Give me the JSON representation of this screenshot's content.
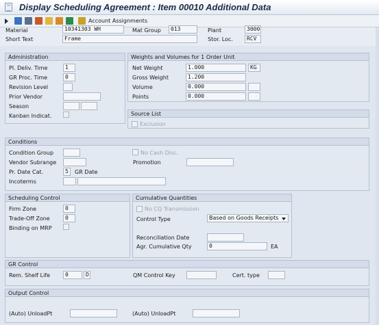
{
  "window": {
    "title": "Display Scheduling Agreement : Item 00010 Additional Data"
  },
  "toolbar": {
    "icons": [
      "execute-arrow-icon",
      "print-icon",
      "find-icon",
      "find-next-icon",
      "create-icon",
      "change-icon",
      "display-icon",
      "document-icon"
    ],
    "account_assignments_label": "Account Assignments"
  },
  "header": {
    "material_label": "Material",
    "material_value": "10341303 WH",
    "mat_group_label": "Mat Group",
    "mat_group_value": "013",
    "plant_label": "Plant",
    "plant_value": "3000",
    "short_text_label": "Short Text",
    "short_text_value": "Frame",
    "stor_loc_label": "Stor. Loc.",
    "stor_loc_value": "RCV"
  },
  "administration": {
    "title": "Administration",
    "pl_deliv_label": "Pl. Deliv. Time",
    "pl_deliv_value": "1",
    "gr_proc_label": "GR Proc. Time",
    "gr_proc_value": "0",
    "revision_label": "Revision Level",
    "prior_vendor_label": "Prior Vendor",
    "season_label": "Season",
    "kanban_label": "Kanban Indicat."
  },
  "weights": {
    "title": "Weights and Volumes for 1 Order Unit",
    "net_weight_label": "Net Weight",
    "net_weight_value": "1.000",
    "net_weight_unit": "KG",
    "gross_weight_label": "Gross Weight",
    "gross_weight_value": "1.200",
    "volume_label": "Volume",
    "volume_value": "0.000",
    "points_label": "Points",
    "points_value": "0.000"
  },
  "source_list": {
    "title": "Source List",
    "exclusion_label": "Exclusion"
  },
  "conditions": {
    "title": "Conditions",
    "condition_group_label": "Condition Group",
    "no_cash_disc_label": "No Cash Disc.",
    "vendor_subrange_label": "Vendor Subrange",
    "promotion_label": "Promotion",
    "pr_date_cat_label": "Pr. Date Cat.",
    "pr_date_cat_value": "5",
    "gr_date_label": "GR Date",
    "incoterms_label": "Incoterms"
  },
  "scheduling": {
    "title": "Scheduling Control",
    "firm_zone_label": "Firm Zone",
    "firm_zone_value": "0",
    "trade_off_label": "Trade-Off Zone",
    "trade_off_value": "0",
    "binding_label": "Binding on MRP"
  },
  "cumulative": {
    "title": "Cumulative Quantities",
    "no_cq_label": "No CQ Transmission",
    "control_type_label": "Control Type",
    "control_type_value": "Based on Goods Receipts",
    "reconciliation_label": "Reconciliation Date",
    "agr_cum_label": "Agr. Cumulative Qty",
    "agr_cum_value": "0",
    "agr_cum_unit": "EA"
  },
  "gr_control": {
    "title": "GR Control",
    "rem_shelf_label": "Rem. Shelf Life",
    "rem_shelf_value": "0",
    "rem_shelf_unit": "D",
    "qm_control_label": "QM Control Key",
    "cert_type_label": "Cert. type"
  },
  "output_control": {
    "title": "Output Control",
    "unload_pt_label_1": "(Auto) UnloadPt",
    "unload_pt_label_2": "(Auto) UnloadPt"
  },
  "colors": {
    "background": "#dfe6f0",
    "group_header": "#d3dce8",
    "title_text": "#1c2e4a"
  }
}
